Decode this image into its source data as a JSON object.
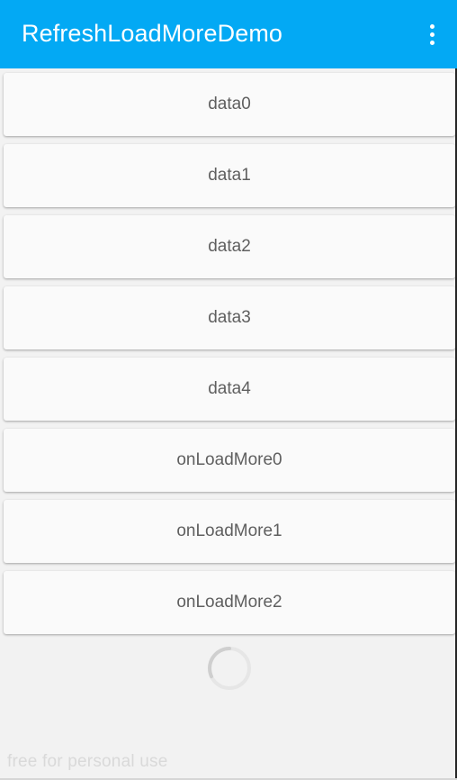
{
  "app_bar": {
    "title": "RefreshLoadMoreDemo",
    "color": "#03a9f4",
    "overflow_icon": "more-vert-icon"
  },
  "list": {
    "items": [
      {
        "label": "data0"
      },
      {
        "label": "data1"
      },
      {
        "label": "data2"
      },
      {
        "label": "data3"
      },
      {
        "label": "data4"
      },
      {
        "label": "onLoadMore0"
      },
      {
        "label": "onLoadMore1"
      },
      {
        "label": "onLoadMore2"
      }
    ]
  },
  "loading_indicator": {
    "icon": "progress-spinner-icon"
  },
  "watermark": "free for personal use"
}
